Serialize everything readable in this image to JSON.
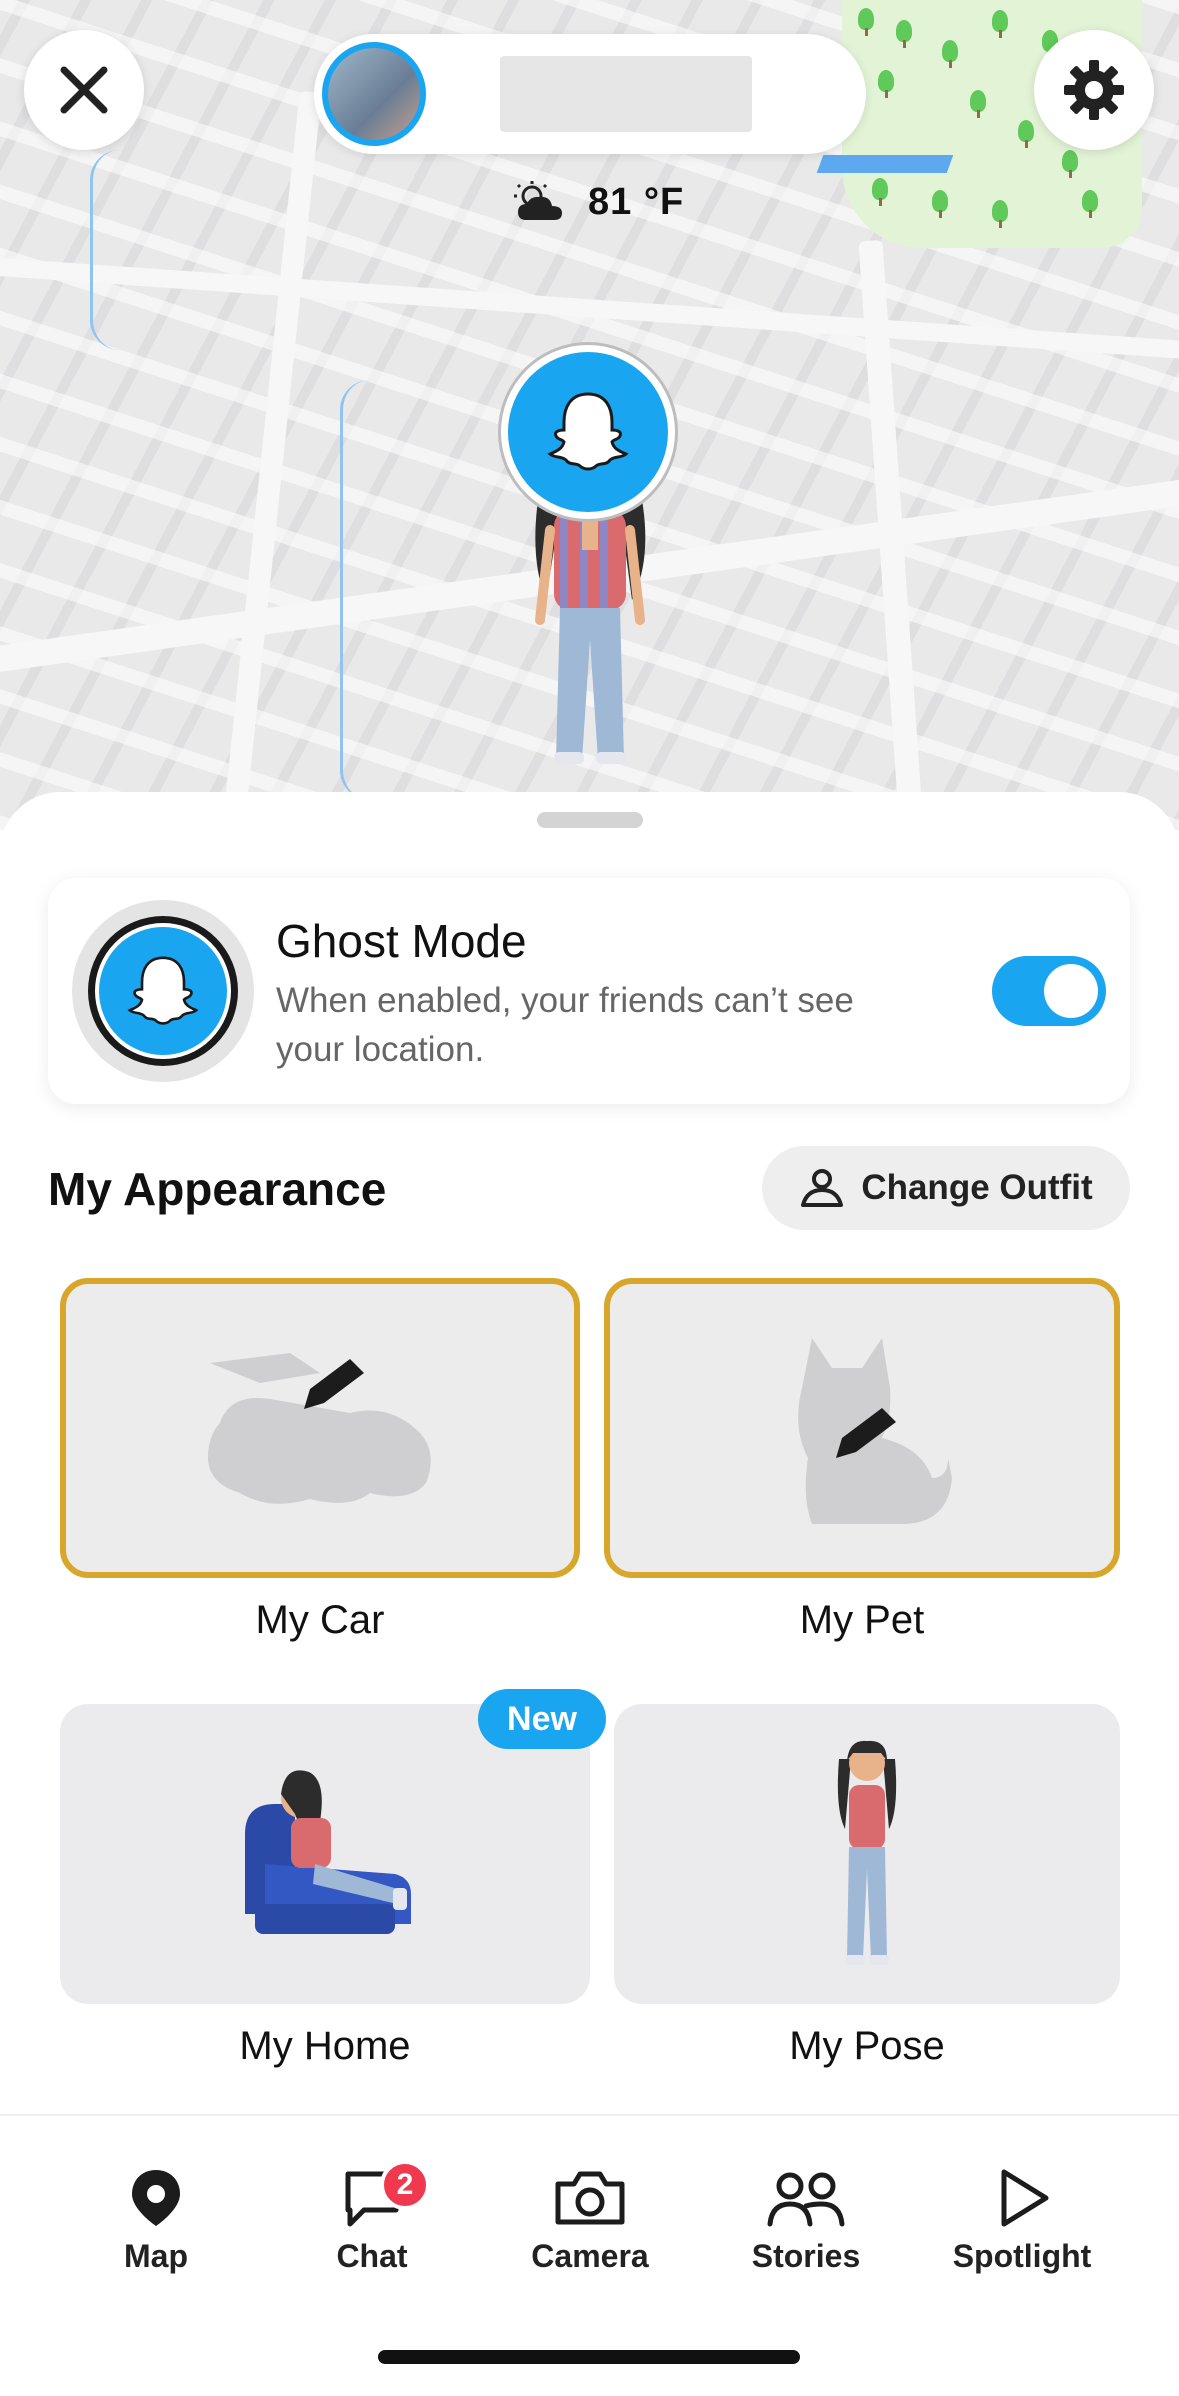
{
  "header": {
    "close_icon": "close-icon",
    "settings_icon": "gear-icon",
    "profile_name": ""
  },
  "weather": {
    "icon": "partly-cloudy-icon",
    "temperature": "81 °F"
  },
  "ghost_mode": {
    "title": "Ghost Mode",
    "description": "When enabled, your friends can’t see your location.",
    "enabled": true
  },
  "appearance": {
    "title": "My Appearance",
    "change_outfit_label": "Change Outfit",
    "tiles": [
      {
        "label": "My Car",
        "icon": "car-silhouette-edit-icon"
      },
      {
        "label": "My Pet",
        "icon": "dog-silhouette-edit-icon"
      },
      {
        "label": "My Home",
        "badge": "New",
        "icon": "bitmoji-recliner"
      },
      {
        "label": "My Pose",
        "icon": "bitmoji-standing"
      }
    ]
  },
  "tabbar": {
    "tabs": [
      {
        "label": "Map",
        "icon": "map-pin-icon"
      },
      {
        "label": "Chat",
        "icon": "chat-icon",
        "badge": "2"
      },
      {
        "label": "Camera",
        "icon": "camera-icon"
      },
      {
        "label": "Stories",
        "icon": "stories-icon"
      },
      {
        "label": "Spotlight",
        "icon": "spotlight-icon"
      }
    ]
  },
  "colors": {
    "accent": "#1aa5f0",
    "gold_border": "#d9a62c",
    "badge_red": "#f0384f"
  }
}
